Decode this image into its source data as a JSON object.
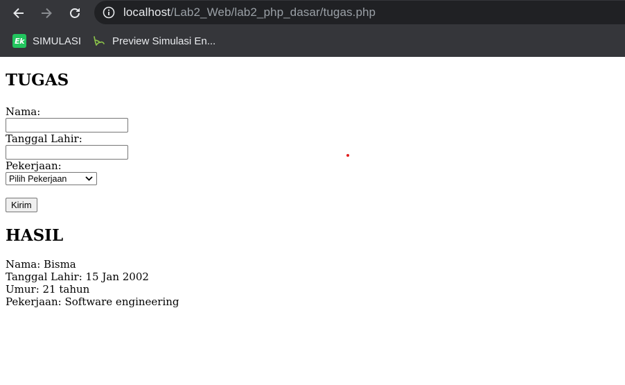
{
  "browser": {
    "url_host": "localhost",
    "url_path": "/Lab2_Web/lab2_php_dasar/tugas.php",
    "bookmarks": [
      {
        "label": "SIMULASI",
        "icon": "ek-logo-icon"
      },
      {
        "label": "Preview Simulasi En...",
        "icon": "leaf-logo-icon"
      }
    ]
  },
  "form": {
    "heading": "TUGAS",
    "nama_label": "Nama:",
    "nama_value": "",
    "tanggal_label": "Tanggal Lahir:",
    "tanggal_value": "",
    "pekerjaan_label": "Pekerjaan:",
    "pekerjaan_selected": "Pilih Pekerjaan",
    "submit_label": "Kirim"
  },
  "hasil": {
    "heading": "HASIL",
    "nama": "Nama: Bisma",
    "tanggal_lahir": "Tanggal Lahir: 15 Jan 2002",
    "umur": "Umur: 21 tahun",
    "pekerjaan": "Pekerjaan: Software engineering"
  },
  "colors": {
    "chrome_bg": "#35363a",
    "omnibox_bg": "#202124",
    "ek_icon": "#22c55e",
    "cursor_dot": "#e11d1d"
  }
}
